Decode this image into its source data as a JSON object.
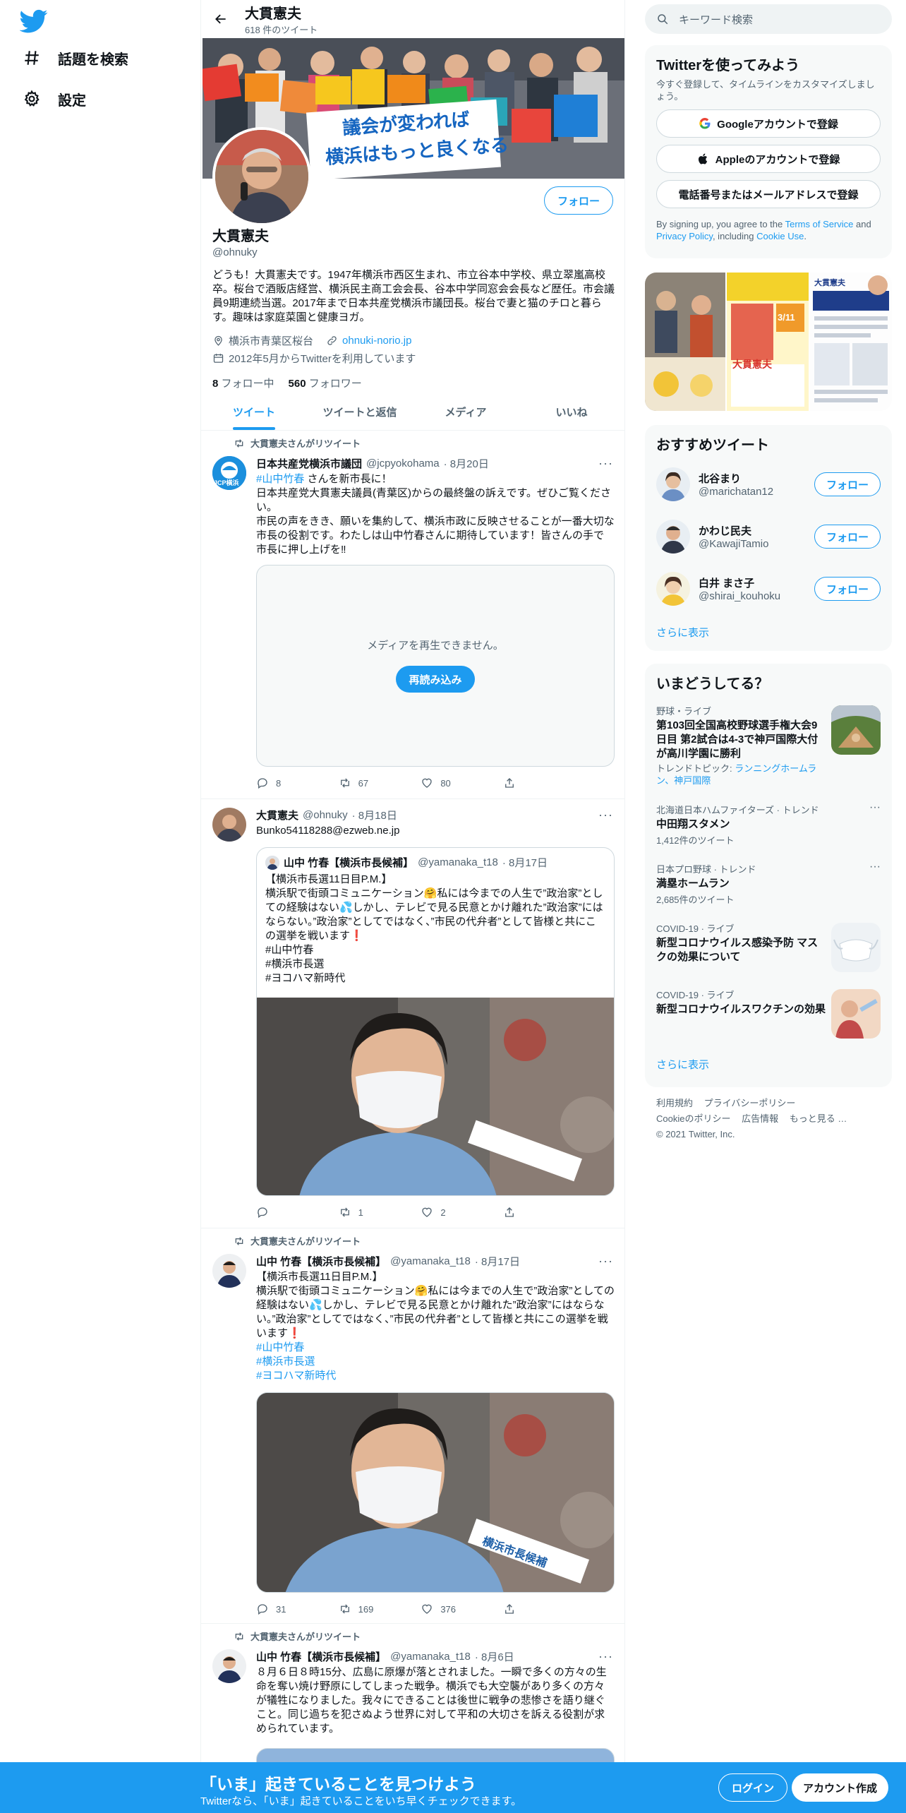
{
  "nav": {
    "explore": "話題を検索",
    "settings": "設定"
  },
  "profile": {
    "header_name": "大貫憲夫",
    "tweet_count": "618 件のツイート",
    "name": "大貫憲夫",
    "handle": "@ohnuky",
    "follow": "フォロー",
    "bio": "どうも！大貫憲夫です。1947年横浜市西区生まれ、市立谷本中学校、県立翠嵐高校卒。桜台で酒販店経営、横浜民主商工会会長、谷本中学同窓会会長など歴任。市会議員9期連続当選。2017年まで日本共産党横浜市議団長。桜台で妻と猫のチロと暮らす。趣味は家庭菜園と健康ヨガ。",
    "location": "横浜市青葉区桜台",
    "website": "ohnuki-norio.jp",
    "joined": "2012年5月からTwitterを利用しています",
    "following_count": "8",
    "following_label": "フォロー中",
    "followers_count": "560",
    "followers_label": "フォロワー",
    "banner_text_1": "議会が変われば",
    "banner_text_2": "横浜はもっと良くなる"
  },
  "tabs": [
    "ツイート",
    "ツイートと返信",
    "メディア",
    "いいね"
  ],
  "tweets": [
    {
      "retweet_label": "大貫憲夫さんがリツイート",
      "name": "日本共産党横浜市議団",
      "handle": "@jcpyokohama",
      "date": "· 8月20日",
      "hashtag": "#山中竹春",
      "line1": " さんを新市長に！",
      "line2": "日本共産党大貫憲夫議員(青葉区)からの最終盤の訴えです。ぜひご覧ください。",
      "line3": "市民の声をきき、願いを集約して、横浜市政に反映させることが一番大切な市長の役割です。わたしは山中竹春さんに期待しています！皆さんの手で市長に押し上げを‼",
      "media_error": "メディアを再生できません。",
      "reload": "再読み込み",
      "avatar_text": "JCP横浜",
      "replies": "8",
      "retweets": "67",
      "likes": "80"
    },
    {
      "name": "大貫憲夫",
      "handle": "@ohnuky",
      "date": "· 8月18日",
      "text": "Bunko54118288@ezweb.ne.jp",
      "quote": {
        "name": "山中 竹春【横浜市長候補】",
        "handle": "@yamanaka_t18",
        "date": "· 8月17日",
        "lines": [
          "【横浜市長選11日目P.M.】",
          "横浜駅で街頭コミュニケーション🤗私には今までの人生で”政治家”としての経験はない💦しかし、テレビで見る民意とかけ離れた”政治家”にはならない。”政治家”としてではなく、”市民の代弁者”として皆様と共にこの選挙を戦います❗",
          "#山中竹春",
          "#横浜市長選",
          "#ヨコハマ新時代"
        ]
      },
      "replies": "",
      "retweets": "1",
      "likes": "2"
    },
    {
      "retweet_label": "大貫憲夫さんがリツイート",
      "name": "山中 竹春【横浜市長候補】",
      "handle": "@yamanaka_t18",
      "date": "· 8月17日",
      "lines": [
        "【横浜市長選11日目P.M.】",
        "横浜駅で街頭コミュニケーション🤗私には今までの人生で”政治家”としての経験はない💦しかし、テレビで見る民意とかけ離れた”政治家”にはならない。”政治家”としてではなく、”市民の代弁者”として皆様と共にこの選挙を戦います❗"
      ],
      "tags": [
        "#山中竹春",
        "#横浜市長選",
        "#ヨコハマ新時代"
      ],
      "sash": "横浜市長候補",
      "replies": "31",
      "retweets": "169",
      "likes": "376"
    },
    {
      "retweet_label": "大貫憲夫さんがリツイート",
      "name": "山中 竹春【横浜市長候補】",
      "handle": "@yamanaka_t18",
      "date": "· 8月6日",
      "text": "８月６日８時15分、広島に原爆が落とされました。一瞬で多くの方々の生命を奪い焼け野原にしてしまった戦争。横浜でも大空襲があり多くの方々が犠牲になりました。我々にできることは後世に戦争の悲惨さを語り継ぐこと。同じ過ちを犯さぬよう世界に対して平和の大切さを訴える役割が求められています。"
    }
  ],
  "search": {
    "placeholder": "キーワード検索"
  },
  "signup_card": {
    "title": "Twitterを使ってみよう",
    "desc": "今すぐ登録して、タイムラインをカスタマイズしましょう。",
    "google": "Googleアカウントで登録",
    "apple": "Appleのアカウントで登録",
    "phone": "電話番号またはメールアドレスで登録",
    "legal_1": "By signing up, you agree to the ",
    "terms": "Terms of Service",
    "legal_2": " and ",
    "privacy": "Privacy Policy",
    "legal_3": ", including ",
    "cookie": "Cookie Use",
    "legal_4": "."
  },
  "photos": {
    "p2_a": "大貫憲夫",
    "p2_b": "3/11",
    "p3_a": "大貫憲夫"
  },
  "recommend": {
    "title": "おすすめツイート",
    "users": [
      {
        "name": "北谷まり",
        "handle": "@marichatan12"
      },
      {
        "name": "かわじ民夫",
        "handle": "@KawajiTamio"
      },
      {
        "name": "白井 まさ子",
        "handle": "@shirai_kouhoku"
      }
    ],
    "follow": "フォロー",
    "more": "さらに表示"
  },
  "trends": {
    "title": "いまどうしてる？",
    "items": [
      {
        "ctx": "野球・ライブ",
        "title": "第103回全国高校野球選手権大会9日目 第2試合は4-3で神戸国際大付が高川学園に勝利",
        "topic_label": "トレンドトピック: ",
        "topic": "ランニングホームラン、神戸国際"
      },
      {
        "ctx": "北海道日本ハムファイターズ · トレンド",
        "title": "中田翔スタメン",
        "count": "1,412件のツイート"
      },
      {
        "ctx": "日本プロ野球 · トレンド",
        "title": "満塁ホームラン",
        "count": "2,685件のツイート"
      },
      {
        "ctx": "COVID-19 · ライブ",
        "title": "新型コロナウイルス感染予防 マスクの効果について"
      },
      {
        "ctx": "COVID-19 · ライブ",
        "title": "新型コロナウイルスワクチンの効果"
      }
    ],
    "more": "さらに表示"
  },
  "footer": {
    "links": [
      "利用規約",
      "プライバシーポリシー",
      "Cookieのポリシー",
      "広告情報",
      "もっと見る …"
    ],
    "copyright": "© 2021 Twitter, Inc."
  },
  "bottom": {
    "title": "「いま」起きていることを見つけよう",
    "sub": "Twitterなら、「いま」起きていることをいち早くチェックできます。",
    "login": "ログイン",
    "signup": "アカウント作成"
  }
}
